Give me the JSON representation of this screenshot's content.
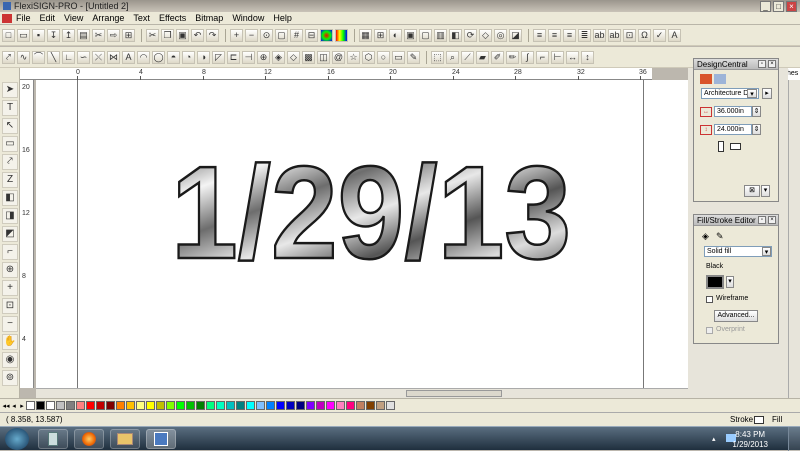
{
  "window": {
    "title": "FlexiSIGN-PRO - [Untitled 2]",
    "controls": [
      "_",
      "□",
      "×"
    ]
  },
  "menu": [
    "File",
    "Edit",
    "View",
    "Arrange",
    "Text",
    "Effects",
    "Bitmap",
    "Window",
    "Help"
  ],
  "ruler_h_labels": [
    "0",
    "4",
    "8",
    "12",
    "16",
    "20",
    "24",
    "28",
    "32",
    "36"
  ],
  "ruler_v_labels": [
    "20",
    "16",
    "12",
    "8",
    "4"
  ],
  "units": "inches",
  "artwork": {
    "text": "1/29/13",
    "style": "chrome-bevel"
  },
  "design_central": {
    "title": "DesignCentral",
    "material": "Architecture D",
    "width": "36.000in",
    "height": "24.000in"
  },
  "fill_stroke": {
    "title": "Fill/Stroke Editor",
    "fill_type": "Solid fill",
    "color_name": "Black",
    "wireframe_label": "Wireframe",
    "advanced_label": "Advanced...",
    "overprint_label": "Overprint"
  },
  "palette_colors": [
    "#000000",
    "#ffffff",
    "#c0c0c0",
    "#808080",
    "#ff8080",
    "#ff0000",
    "#c00000",
    "#800000",
    "#ff8000",
    "#ffc000",
    "#ffff80",
    "#ffff00",
    "#c0c000",
    "#80ff00",
    "#00ff00",
    "#00c000",
    "#008000",
    "#00ff80",
    "#00ffc0",
    "#00c0c0",
    "#008080",
    "#00ffff",
    "#80c0ff",
    "#0080ff",
    "#0000ff",
    "#0000c0",
    "#000080",
    "#8000ff",
    "#c000c0",
    "#ff00ff",
    "#ff80c0",
    "#ff0080",
    "#c08060",
    "#804000",
    "#c0a080",
    "#e0e0e0"
  ],
  "status": {
    "coords": "( 8.358,  13.587)",
    "stroke_label": "Stroke",
    "fill_label": "Fill"
  },
  "clock": {
    "time": "8:43 PM",
    "date": "1/29/2013"
  }
}
